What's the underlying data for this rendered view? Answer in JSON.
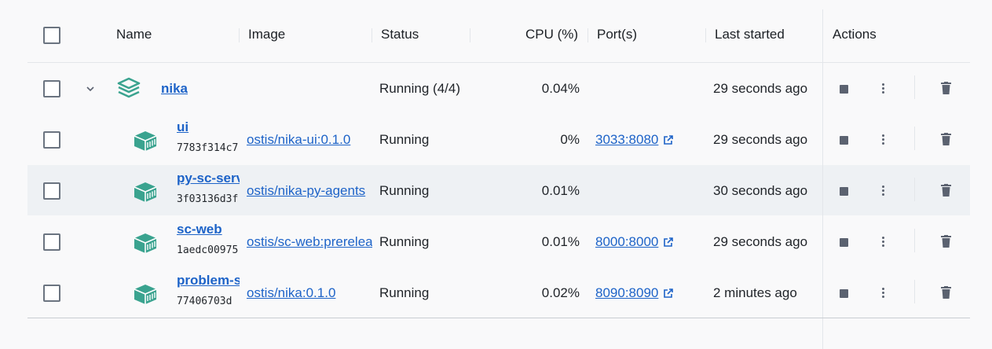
{
  "headers": {
    "name": "Name",
    "image": "Image",
    "status": "Status",
    "cpu": "CPU (%)",
    "ports": "Port(s)",
    "last_started": "Last started",
    "actions": "Actions"
  },
  "group": {
    "name": "nika",
    "status": "Running (4/4)",
    "cpu": "0.04%",
    "last_started": "29 seconds ago"
  },
  "containers": [
    {
      "name": "ui",
      "id": "7783f314c7",
      "image": "ostis/nika-ui:0.1.0",
      "status": "Running",
      "cpu": "0%",
      "port": "3033:8080",
      "last_started": "29 seconds ago"
    },
    {
      "name": "py-sc-server",
      "id": "3f03136d3f",
      "image": "ostis/nika-py-agents",
      "status": "Running",
      "cpu": "0.01%",
      "port": "",
      "last_started": "30 seconds ago"
    },
    {
      "name": "sc-web",
      "id": "1aedc00975",
      "image": "ostis/sc-web:prerelease",
      "status": "Running",
      "cpu": "0.01%",
      "port": "8000:8000",
      "last_started": "29 seconds ago"
    },
    {
      "name": "problem-solver",
      "id": "77406703d",
      "image": "ostis/nika:0.1.0",
      "status": "Running",
      "cpu": "0.02%",
      "port": "8090:8090",
      "last_started": "2 minutes ago"
    }
  ],
  "colors": {
    "accent": "#1d63c8",
    "icon_teal": "#3aa38f",
    "hover_row": "#eef1f4"
  },
  "icons": {
    "expand": "chevron-down-icon",
    "group": "layers-icon",
    "container": "container-icon",
    "external": "external-link-icon",
    "stop": "stop-icon",
    "more": "kebab-menu-icon",
    "delete": "trash-icon"
  }
}
